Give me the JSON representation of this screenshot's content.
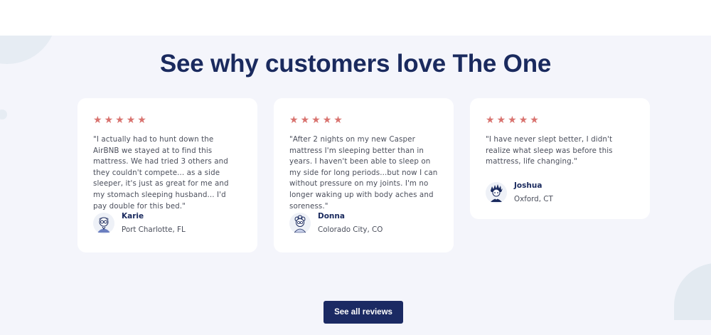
{
  "section": {
    "title": "See why customers love The One"
  },
  "reviews": [
    {
      "rating": 5,
      "quote": "\"I actually had to hunt down the AirBNB we stayed at to find this mattress. We had tried 3 others and they couldn't compete... as a side sleeper, it's just as great for me and my stomach sleeping husband... I'd pay double for this bed.\"",
      "name": "Karie",
      "location": "Port Charlotte, FL",
      "avatar_icon": "man-with-glasses-avatar-icon"
    },
    {
      "rating": 5,
      "quote": "\"After 2 nights on my new Casper mattress I'm sleeping better than in years. I haven't been able to sleep on my side for long periods...but now I can without pressure on my joints. I'm no longer waking up with body aches and soreness.\"",
      "name": "Donna",
      "location": "Colorado City, CO",
      "avatar_icon": "woman-curly-hair-avatar-icon"
    },
    {
      "rating": 5,
      "quote": "\"I have never slept better, I didn't realize what sleep was before this mattress, life changing.\"",
      "name": "Joshua",
      "location": "Oxford, CT",
      "avatar_icon": "man-spiky-hair-avatar-icon"
    }
  ],
  "cta": {
    "label": "See all reviews"
  },
  "colors": {
    "title": "#1a2a5e",
    "star": "#d9736f",
    "section_bg": "#f4f5fb",
    "button_bg": "#1b2a63"
  }
}
